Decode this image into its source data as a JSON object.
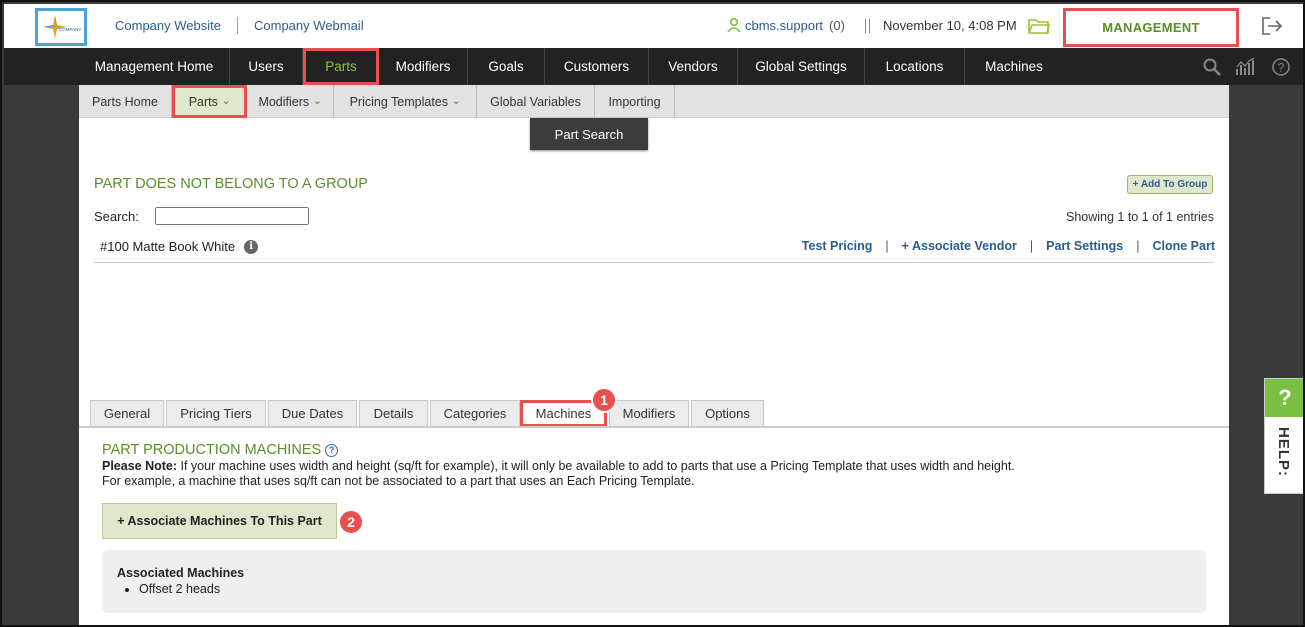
{
  "topbar": {
    "company_website": "Company Website",
    "company_webmail": "Company Webmail",
    "username": "cbms.support",
    "user_count": "(0)",
    "datetime": "November 10, 4:08 PM",
    "management": "MANAGEMENT"
  },
  "mainnav": {
    "items": [
      {
        "label": "Management Home"
      },
      {
        "label": "Users"
      },
      {
        "label": "Parts"
      },
      {
        "label": "Modifiers"
      },
      {
        "label": "Goals"
      },
      {
        "label": "Customers"
      },
      {
        "label": "Vendors"
      },
      {
        "label": "Global Settings"
      },
      {
        "label": "Locations"
      },
      {
        "label": "Machines"
      }
    ],
    "active": "Parts",
    "icons": [
      "search-icon",
      "analytics-icon",
      "help-circle-icon"
    ]
  },
  "subnav": {
    "items": [
      {
        "label": "Parts Home"
      },
      {
        "label": "Parts"
      },
      {
        "label": "Modifiers"
      },
      {
        "label": "Pricing Templates"
      },
      {
        "label": "Global Variables"
      },
      {
        "label": "Importing"
      }
    ],
    "dropdown_label": "Part Search"
  },
  "group": {
    "title": "PART DOES NOT BELONG TO A GROUP",
    "add_button": "+ Add To Group",
    "search_label": "Search:",
    "search_value": "",
    "showing": "Showing 1 to 1 of 1 entries",
    "part_name": "#100 Matte Book White",
    "actions": {
      "test_pricing": "Test Pricing",
      "associate_vendor": "+ Associate Vendor",
      "part_settings": "Part Settings",
      "clone_part": "Clone Part",
      "separator": "|"
    }
  },
  "tabs": {
    "items": [
      {
        "label": "General"
      },
      {
        "label": "Pricing Tiers"
      },
      {
        "label": "Due Dates"
      },
      {
        "label": "Details"
      },
      {
        "label": "Categories"
      },
      {
        "label": "Machines"
      },
      {
        "label": "Modifiers"
      },
      {
        "label": "Options"
      }
    ],
    "active": "Machines"
  },
  "machines_section": {
    "title": "PART PRODUCTION MACHINES",
    "note_bold": "Please Note:",
    "note_line1": " If your machine uses width and height (sq/ft for example), it will only be available to add to parts that use a Pricing Template that uses width and height.",
    "note_line2": "For example, a machine that uses sq/ft can not be associated to a part that uses an Each Pricing Template.",
    "associate_button": "+ Associate Machines To This Part",
    "associated_title": "Associated Machines",
    "associated_list": [
      "Offset 2 heads"
    ]
  },
  "callouts": [
    "1",
    "2"
  ],
  "help": {
    "q": "?",
    "label": "HELP:"
  },
  "colors": {
    "accent_green": "#5a8f2a",
    "nav_active_green": "#8cc63f",
    "link_blue": "#2b5d8e",
    "highlight_red": "#e94f4f",
    "nav_dark": "#222222",
    "help_green": "#7ac143"
  }
}
